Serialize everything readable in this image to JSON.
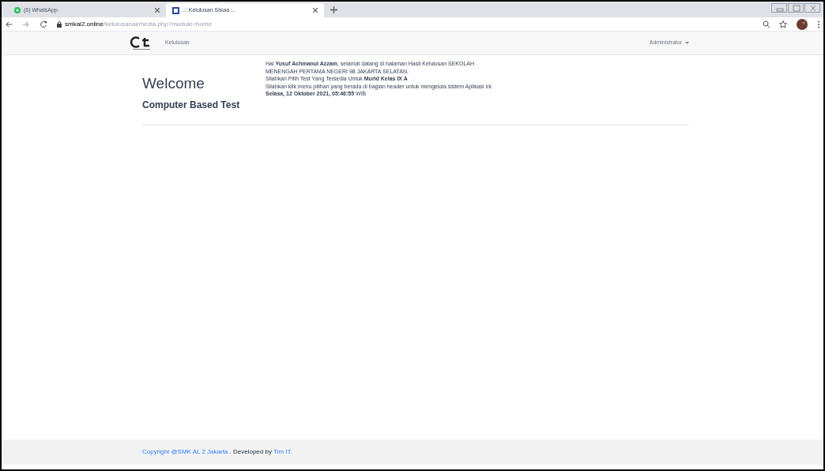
{
  "browser": {
    "tabs": [
      {
        "title": "(6) WhatsApp",
        "selected": false
      },
      {
        "title": ".:: Kelulusan Siswa :..",
        "selected": true
      }
    ],
    "url_host": "smkal2.online",
    "url_path": "/kelulusanal/media.php?module=home"
  },
  "navbar": {
    "menu": [
      "Kelulusan"
    ],
    "user": "Administrator"
  },
  "welcome": {
    "title": "Welcome",
    "subtitle": "Computer Based Test",
    "lines": [
      "Hai **Yusuf Achmanul Azzam**, selamat datang di halaman Hasil Kelulusan SEKOLAH MENENGAH PERTAMA NEGERI 98 JAKARTA SELATAN.",
      "Silahkan Pilih Test Yang Tersedia Untuk **Murid Kelas IX A**",
      "Silahkan klik menu pilihan yang berada di bagian header untuk mengelola sistem Aplikasi ini.",
      "**Selasa, 12 Oktober 2021, 05:46:55** WIB"
    ]
  },
  "footer": {
    "copyright": "Copyright @SMK AL 2 Jakarta",
    "developed": ". Developed by",
    "team": "Tim IT."
  }
}
